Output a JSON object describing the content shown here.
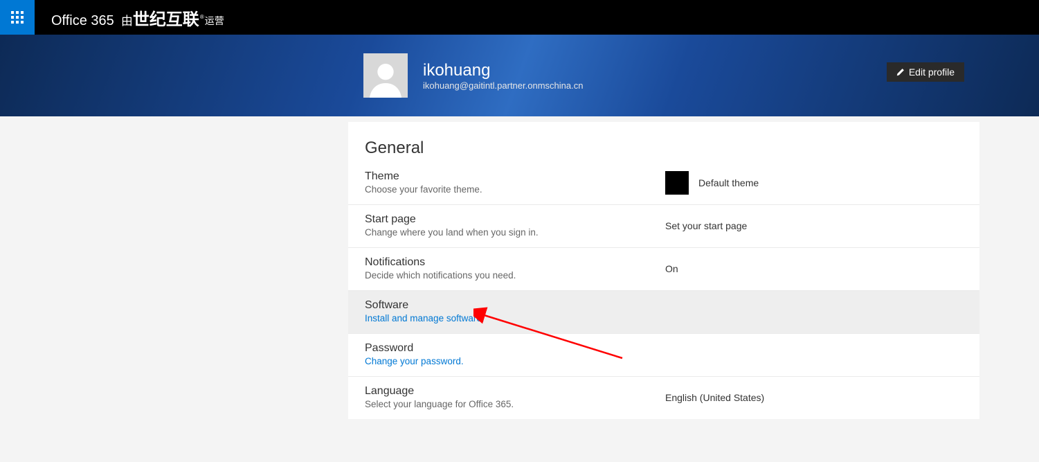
{
  "topbar": {
    "brand": "Office 365",
    "operated_by_prefix": "由",
    "operated_by_big": "世纪互联",
    "operated_by_suffix": "运营"
  },
  "profile": {
    "name": "ikohuang",
    "email": "ikohuang@gaitintl.partner.onmschina.cn",
    "edit_label": "Edit profile"
  },
  "settings": {
    "section_title": "General",
    "rows": {
      "theme": {
        "title": "Theme",
        "desc": "Choose your favorite theme.",
        "value": "Default theme"
      },
      "start_page": {
        "title": "Start page",
        "desc": "Change where you land when you sign in.",
        "value": "Set your start page"
      },
      "notifications": {
        "title": "Notifications",
        "desc": "Decide which notifications you need.",
        "value": "On"
      },
      "software": {
        "title": "Software",
        "link": "Install and manage software."
      },
      "password": {
        "title": "Password",
        "link": "Change your password."
      },
      "language": {
        "title": "Language",
        "desc": "Select your language for Office 365.",
        "value": "English (United States)"
      }
    }
  }
}
